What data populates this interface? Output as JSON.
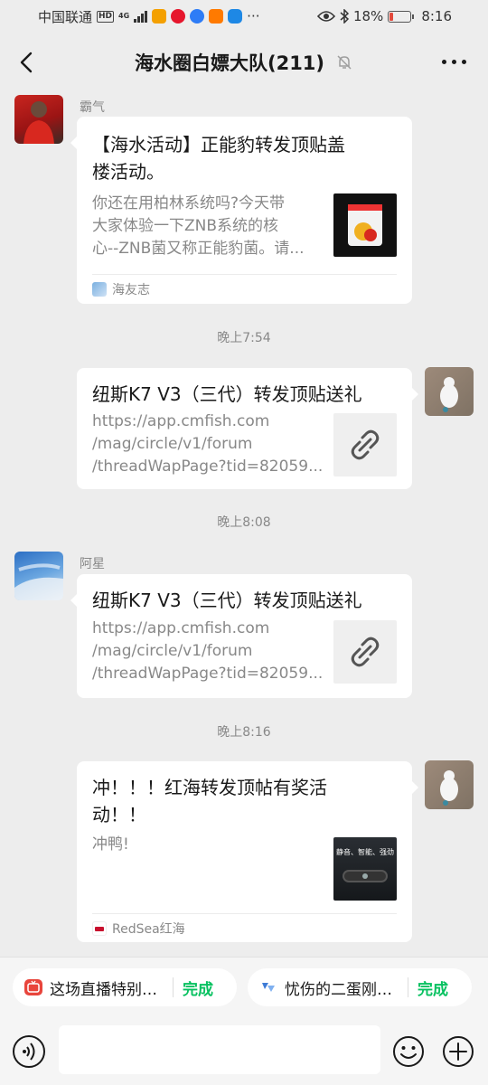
{
  "status_bar": {
    "carrier": "中国联通",
    "network": "4G",
    "more": "···",
    "battery": "18%",
    "time": "8:16"
  },
  "nav": {
    "title": "海水圈白嫖大队(211)",
    "icons": [
      "back-arrow-icon",
      "mute-bell-icon",
      "more-dots-icon"
    ]
  },
  "messages": [
    {
      "side": "left",
      "sender": "霸气",
      "title_lines": [
        "【海水活动】正能豹转发顶贴盖",
        "楼活动。"
      ],
      "desc": "你还在用柏林系统吗?今天带\n大家体验一下ZNB系统的核\n心--ZNB菌又称正能豹菌。请...",
      "source": "海友志",
      "thumb": "product-bucket-image"
    },
    {
      "time": "晚上7:54"
    },
    {
      "side": "right",
      "title": "纽斯K7 V3（三代）转发顶贴送礼",
      "desc": "https://app.cmfish.com\n/mag/circle/v1/forum\n/threadWapPage?tid=82059...",
      "thumb": "link-icon"
    },
    {
      "time": "晚上8:08"
    },
    {
      "side": "left",
      "sender": "阿星",
      "title": "纽斯K7 V3（三代）转发顶贴送礼",
      "desc": "https://app.cmfish.com\n/mag/circle/v1/forum\n/threadWapPage?tid=82059...",
      "thumb": "link-icon"
    },
    {
      "time": "晚上8:16"
    },
    {
      "side": "right",
      "title_lines": [
        "冲！！！红海转发顶帖有奖活",
        "动！！"
      ],
      "desc": "冲鸭!",
      "source": "RedSea红海",
      "thumb_text": "静音、智能、强劲"
    }
  ],
  "quick_replies": [
    {
      "text": "这场直播特别好看，快来！",
      "done": "完成"
    },
    {
      "text": "忧伤的二蛋刚刚分享了动态",
      "done": "完成"
    }
  ],
  "input": {
    "placeholder": ""
  },
  "colors": {
    "accent": "#07c160",
    "background": "#ededed",
    "bubble": "#ffffff"
  }
}
